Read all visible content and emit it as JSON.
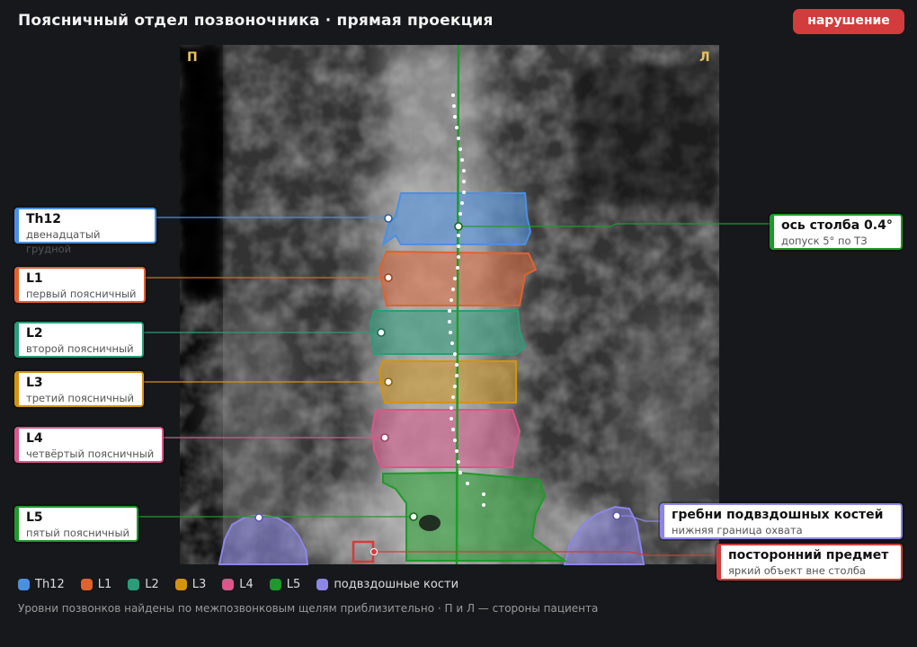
{
  "header": {
    "title": "Поясничный отдел позвоночника · прямая проекция",
    "status_badge": "нарушение"
  },
  "scan": {
    "side_right_patient": "П",
    "side_left_patient": "Л"
  },
  "vertebrae": [
    {
      "key": "th12",
      "name": "Th12",
      "description": "двенадцатый грудной",
      "color": "#4a90e2"
    },
    {
      "key": "l1",
      "name": "L1",
      "description": "первый поясничный",
      "color": "#e0622f"
    },
    {
      "key": "l2",
      "name": "L2",
      "description": "второй поясничный",
      "color": "#2a9d78"
    },
    {
      "key": "l3",
      "name": "L3",
      "description": "третий поясничный",
      "color": "#d4930f"
    },
    {
      "key": "l4",
      "name": "L4",
      "description": "четвёртый поясничный",
      "color": "#d9578a"
    },
    {
      "key": "l5",
      "name": "L5",
      "description": "пятый поясничный",
      "color": "#1f9a2a"
    }
  ],
  "axis": {
    "title": "ось столба 0.4°",
    "note": "допуск 5° по ТЗ",
    "color": "#1f9a2a"
  },
  "iliac": {
    "title": "гребни подвздошных костей",
    "note": "нижняя граница охвата",
    "color": "#8c86e6"
  },
  "foreign": {
    "title": "посторонний предмет",
    "note": "яркий объект вне столба",
    "color": "#d23c3c"
  },
  "legend": [
    {
      "label": "Th12",
      "color": "#4a90e2"
    },
    {
      "label": "L1",
      "color": "#e0622f"
    },
    {
      "label": "L2",
      "color": "#2a9d78"
    },
    {
      "label": "L3",
      "color": "#d4930f"
    },
    {
      "label": "L4",
      "color": "#d9578a"
    },
    {
      "label": "L5",
      "color": "#1f9a2a"
    },
    {
      "label": "подвздошные кости",
      "color": "#8c86e6"
    }
  ],
  "footnote": "Уровни позвонков найдены по межпозвонковым щелям приблизительно · П и Л — стороны пациента"
}
